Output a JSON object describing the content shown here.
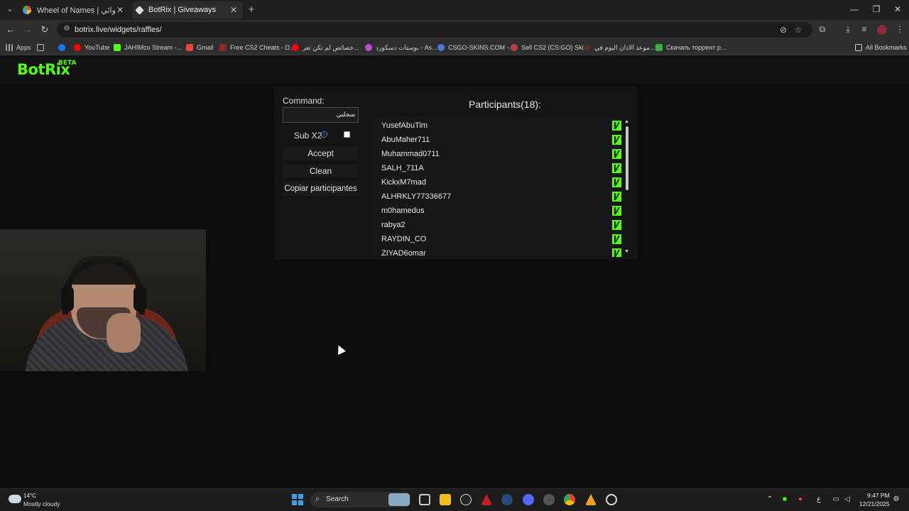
{
  "browser": {
    "tabs": [
      {
        "title": "Wheel of Names | اسم العشوائي",
        "favicon_color": "#e24a4a",
        "active": false
      },
      {
        "title": "BotRix | Giveaways",
        "favicon_color": "#dddddd",
        "active": true
      }
    ],
    "url": "botrix.live/widgets/raffles/",
    "bookmarks": [
      {
        "label": "Apps",
        "color": "#9aa0a6"
      },
      {
        "label": "",
        "color": "#1877f2"
      },
      {
        "label": "YouTube",
        "color": "#ff0000"
      },
      {
        "label": "JAHIMco Stream -...",
        "color": "#53fc18"
      },
      {
        "label": "Gmail",
        "color": "#ea4335"
      },
      {
        "label": "Free CS2 Cheats - D...",
        "color": "#8b2a2a"
      },
      {
        "label": "خصائص لم تكن تعر...",
        "color": "#ff0000"
      },
      {
        "label": "بوستات دسكورد - As...",
        "color": "#b84ad6"
      },
      {
        "label": "CSGO-SKINS.COM -...",
        "color": "#4a7ad6"
      },
      {
        "label": "Sell CS2 (CS:GO) Ski...",
        "color": "#c04040"
      },
      {
        "label": "موعد الاذان اليوم في...",
        "color": "#5a2a2a"
      },
      {
        "label": "Скачать торрент р...",
        "color": "#3ab04a"
      }
    ],
    "all_bookmarks": "All Bookmarks"
  },
  "app": {
    "logo": "BotRix",
    "logo_badge": "BETA",
    "command_label": "Command:",
    "command_value": "سجلني",
    "sub_label": "Sub X2",
    "sub_checked": false,
    "accept_label": "Accept",
    "clean_label": "Clean",
    "copy_label": "Copiar participantes",
    "participants_title": "Participants(18):",
    "participants": [
      "YusefAbuTim",
      "AbuMaher711",
      "Muhammad0711",
      "SALH_711A",
      "KickxM7mad",
      "ALHRKLY77336677",
      "m0hamedus",
      "rabya2",
      "RAYDIN_CO",
      "ZIYAD6omar"
    ],
    "platform_icon": "kick-icon",
    "accent": "#53fc18"
  },
  "taskbar": {
    "temperature": "14°C",
    "weather": "Mostly cloudy",
    "search_label": "Search",
    "time": "9:47 PM",
    "date": "12/21/2025",
    "input_lang": "ع"
  }
}
